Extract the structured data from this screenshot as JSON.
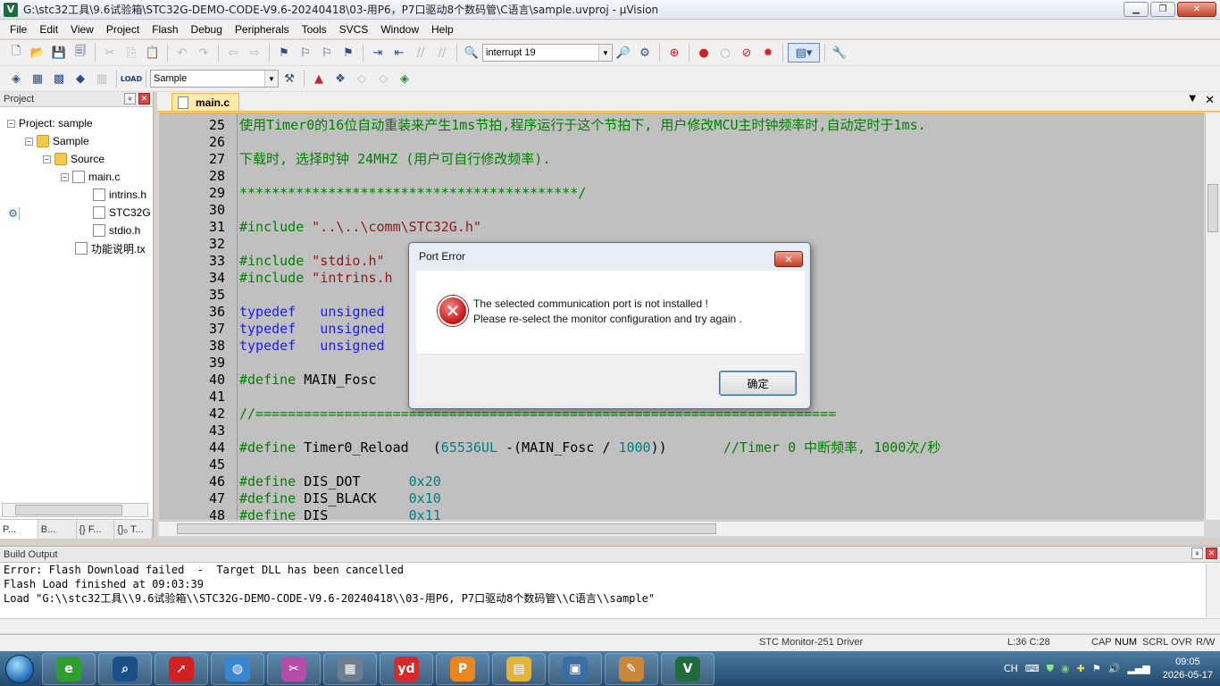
{
  "window": {
    "title": "G:\\stc32工具\\9.6试验箱\\STC32G-DEMO-CODE-V9.6-20240418\\03-用P6，P7口驱动8个数码管\\C语言\\sample.uvproj - µVision",
    "minimize": "▁",
    "maximize": "❐",
    "close": "✕"
  },
  "menu": [
    "File",
    "Edit",
    "View",
    "Project",
    "Flash",
    "Debug",
    "Peripherals",
    "Tools",
    "SVCS",
    "Window",
    "Help"
  ],
  "toolbar": {
    "find_combo": "interrupt 19",
    "target_combo": "Sample",
    "load_label": "LOAD"
  },
  "project_panel": {
    "title": "Project",
    "pin": "🖈",
    "close": "✕",
    "tree": [
      {
        "label": "Project: sample",
        "level": 0,
        "kind": "project"
      },
      {
        "label": "Sample",
        "level": 1,
        "kind": "folder"
      },
      {
        "label": "Source",
        "level": 2,
        "kind": "folder"
      },
      {
        "label": "main.c",
        "level": 3,
        "kind": "file"
      },
      {
        "label": "intrins.h",
        "level": 4,
        "kind": "file"
      },
      {
        "label": "STC32G",
        "level": 4,
        "kind": "file"
      },
      {
        "label": "stdio.h",
        "level": 4,
        "kind": "file"
      },
      {
        "label": "功能说明.tx",
        "level": 3,
        "kind": "file"
      }
    ],
    "tabs": [
      "P...",
      "B...",
      "{} F...",
      "{}₀ T..."
    ]
  },
  "editor": {
    "tab_label": "main.c",
    "dropdown": "▼",
    "close": "✕",
    "lines": [
      {
        "n": "25",
        "parts": [
          {
            "t": "使用Timer0的16位自动重装来产生1ms节拍,程序运行于这个节拍下, 用户修改MCU主时钟频率时,自动定时于1ms.",
            "c": "c-green"
          }
        ]
      },
      {
        "n": "26",
        "parts": []
      },
      {
        "n": "27",
        "parts": [
          {
            "t": "下载时, 选择时钟 24MHZ (用户可自行修改频率).",
            "c": "c-green"
          }
        ]
      },
      {
        "n": "28",
        "parts": []
      },
      {
        "n": "29",
        "parts": [
          {
            "t": "******************************************/",
            "c": "c-green"
          }
        ]
      },
      {
        "n": "30",
        "parts": []
      },
      {
        "n": "31",
        "parts": [
          {
            "t": "#include ",
            "c": "c-pp"
          },
          {
            "t": "\"..\\..\\comm\\STC32G.h\"",
            "c": "c-str"
          }
        ]
      },
      {
        "n": "32",
        "parts": []
      },
      {
        "n": "33",
        "parts": [
          {
            "t": "#include ",
            "c": "c-pp"
          },
          {
            "t": "\"stdio.h\"",
            "c": "c-str"
          }
        ]
      },
      {
        "n": "34",
        "parts": [
          {
            "t": "#include ",
            "c": "c-pp"
          },
          {
            "t": "\"intrins.h",
            "c": "c-str"
          }
        ]
      },
      {
        "n": "35",
        "parts": []
      },
      {
        "n": "36",
        "parts": [
          {
            "t": "typedef   unsigned",
            "c": "c-blue"
          }
        ]
      },
      {
        "n": "37",
        "parts": [
          {
            "t": "typedef   unsigned",
            "c": "c-blue"
          }
        ]
      },
      {
        "n": "38",
        "parts": [
          {
            "t": "typedef   unsigned",
            "c": "c-blue"
          }
        ]
      },
      {
        "n": "39",
        "parts": []
      },
      {
        "n": "40",
        "parts": [
          {
            "t": "#define ",
            "c": "c-pp"
          },
          {
            "t": "MAIN_Fosc",
            "c": "c-plain"
          }
        ]
      },
      {
        "n": "41",
        "parts": []
      },
      {
        "n": "42",
        "parts": [
          {
            "t": "//========================================================================",
            "c": "c-green"
          }
        ]
      },
      {
        "n": "43",
        "parts": []
      },
      {
        "n": "44",
        "parts": [
          {
            "t": "#define ",
            "c": "c-pp"
          },
          {
            "t": "Timer0_Reload   (",
            "c": "c-plain"
          },
          {
            "t": "65536UL",
            "c": "c-num"
          },
          {
            "t": " -(MAIN_Fosc / ",
            "c": "c-plain"
          },
          {
            "t": "1000",
            "c": "c-num"
          },
          {
            "t": "))       ",
            "c": "c-plain"
          },
          {
            "t": "//Timer 0 中断频率, 1000次/秒",
            "c": "c-green"
          }
        ]
      },
      {
        "n": "45",
        "parts": []
      },
      {
        "n": "46",
        "parts": [
          {
            "t": "#define ",
            "c": "c-pp"
          },
          {
            "t": "DIS_DOT      ",
            "c": "c-plain"
          },
          {
            "t": "0x20",
            "c": "c-num"
          }
        ]
      },
      {
        "n": "47",
        "parts": [
          {
            "t": "#define ",
            "c": "c-pp"
          },
          {
            "t": "DIS_BLACK    ",
            "c": "c-plain"
          },
          {
            "t": "0x10",
            "c": "c-num"
          }
        ]
      },
      {
        "n": "48",
        "parts": [
          {
            "t": "#define ",
            "c": "c-pp"
          },
          {
            "t": "DIS_         ",
            "c": "c-plain"
          },
          {
            "t": "0x11",
            "c": "c-num"
          }
        ]
      }
    ]
  },
  "dialog": {
    "title": "Port Error",
    "close": "✕",
    "icon": "✕",
    "message_line1": "The selected communication port is not installed !",
    "message_line2": "Please re-select the monitor configuration and try again .",
    "ok_label": "确定"
  },
  "build_output": {
    "title": "Build Output",
    "lines": [
      "Error: Flash Download failed  -  Target DLL has been cancelled",
      "Flash Load finished at 09:03:39",
      "Load \"G:\\\\stc32工具\\\\9.6试验箱\\\\STC32G-DEMO-CODE-V9.6-20240418\\\\03-用P6, P7口驱动8个数码管\\\\C语言\\\\sample\""
    ]
  },
  "status": {
    "driver": "STC Monitor-251 Driver",
    "position": "L:36 C:28",
    "cap": "CAP",
    "num": "NUM",
    "scrl": "SCRL",
    "ovr": "OVR",
    "rw": "R/W"
  },
  "taskbar": {
    "tray_lang": "CH",
    "time": "09:05",
    "date": "2026-05-17",
    "apps": [
      {
        "name": "ie-icon",
        "glyph": "e",
        "color": "#2f9e2f"
      },
      {
        "name": "search-app-icon",
        "glyph": "⌕",
        "color": "#1a4f8a"
      },
      {
        "name": "swoosh-app-icon",
        "glyph": "➚",
        "color": "#d32020"
      },
      {
        "name": "globe-app-icon",
        "glyph": "◍",
        "color": "#3a86d1"
      },
      {
        "name": "scissors-app-icon",
        "glyph": "✂",
        "color": "#b54da8"
      },
      {
        "name": "calculator-icon",
        "glyph": "▦",
        "color": "#6c7d8f"
      },
      {
        "name": "youdao-icon",
        "glyph": "yd",
        "color": "#d42a2a"
      },
      {
        "name": "pdf-icon",
        "glyph": "P",
        "color": "#e8871e"
      },
      {
        "name": "explorer-icon",
        "glyph": "▤",
        "color": "#e3b43a"
      },
      {
        "name": "remote-desktop-icon",
        "glyph": "▣",
        "color": "#3b6ea5"
      },
      {
        "name": "paint-icon",
        "glyph": "✎",
        "color": "#c9873c"
      },
      {
        "name": "uvision-icon",
        "glyph": "V",
        "color": "#1f6b3a"
      }
    ]
  }
}
